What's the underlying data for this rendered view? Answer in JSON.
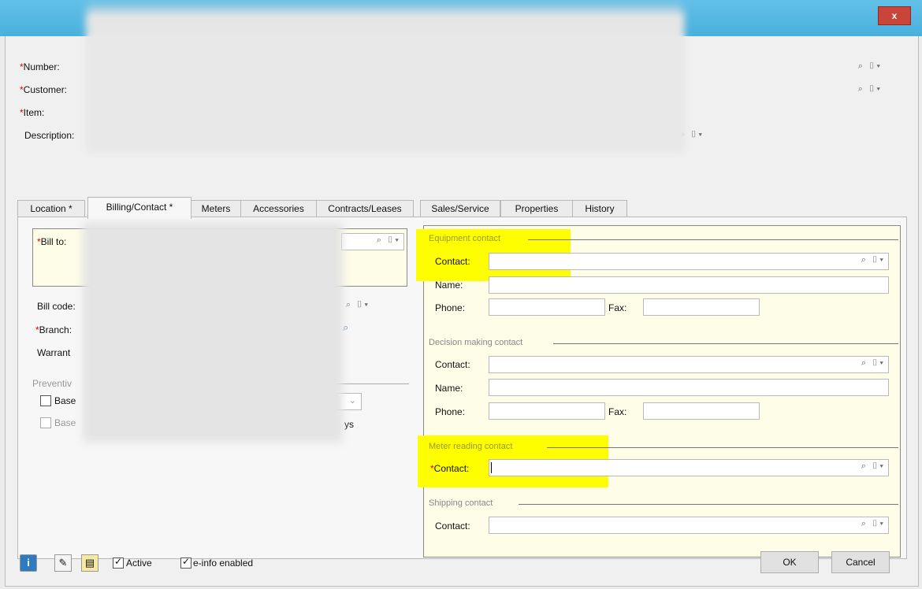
{
  "title_bar": {
    "close_label": "x"
  },
  "header": {
    "number_label": "Number:",
    "customer_label": "Customer:",
    "item_label": "Item:",
    "description_label": "Description:",
    "required_mark": "*"
  },
  "tabs": [
    {
      "label": "Location *"
    },
    {
      "label": "Billing/Contact *"
    },
    {
      "label": "Meters"
    },
    {
      "label": "Accessories"
    },
    {
      "label": "Contracts/Leases"
    },
    {
      "label": "Sales/Service"
    },
    {
      "label": "Properties"
    },
    {
      "label": "History"
    }
  ],
  "billing": {
    "bill_to_label": "Bill to:",
    "bill_code_label": "Bill code:",
    "branch_label": "Branch:",
    "warranty_label": "Warrant",
    "preventive_label": "Preventiv",
    "base1_label": "Base",
    "base2_label": "Base",
    "days_fragment": "ys"
  },
  "contacts": {
    "equipment": {
      "section_label": "Equipment contact",
      "contact_label": "Contact:",
      "name_label": "Name:",
      "phone_label": "Phone:",
      "fax_label": "Fax:"
    },
    "decision": {
      "section_label": "Decision making contact",
      "contact_label": "Contact:",
      "name_label": "Name:",
      "phone_label": "Phone:",
      "fax_label": "Fax:"
    },
    "meter": {
      "section_label": "Meter reading contact",
      "contact_label": "Contact:"
    },
    "shipping": {
      "section_label": "Shipping contact",
      "contact_label": "Contact:"
    }
  },
  "footer": {
    "active_label": "Active",
    "einfo_label": "e-info enabled",
    "ok_label": "OK",
    "cancel_label": "Cancel"
  },
  "icons": {
    "lookup": "⌕ ▯▾",
    "info": "i",
    "attach": "✎",
    "note": "▤"
  },
  "colors": {
    "highlight": "#fefe00",
    "titlebar": "#49b0dd",
    "close": "#c9453a",
    "panel_bg": "#fdfde8"
  }
}
